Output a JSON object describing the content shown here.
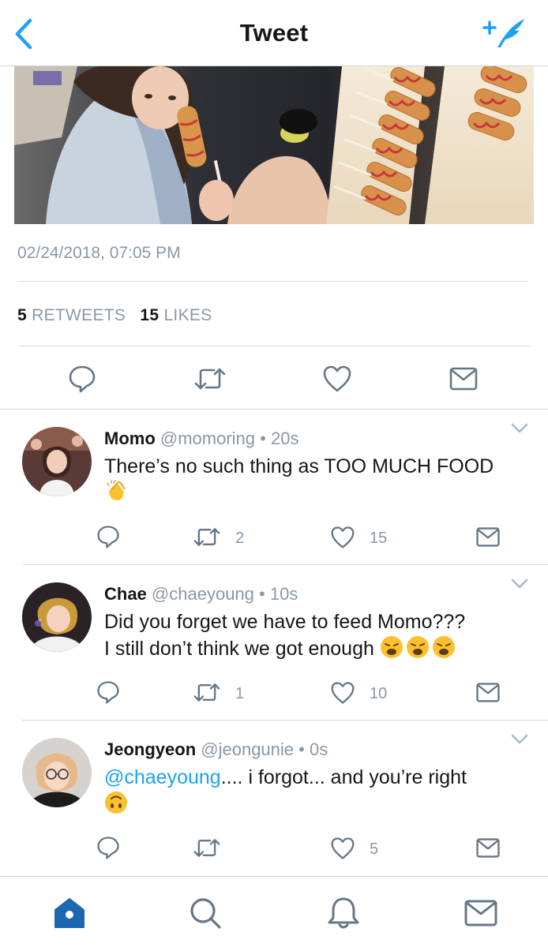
{
  "nav": {
    "title": "Tweet",
    "back_icon": "chevron-left-icon",
    "compose_icon": "compose-tweet-icon"
  },
  "tweet": {
    "timestamp": "02/24/2018, 07:05 PM",
    "retweets_count": "5",
    "retweets_label": "RETWEETS",
    "likes_count": "15",
    "likes_label": "LIKES"
  },
  "replies": [
    {
      "name": "Momo",
      "handle": "@momoring",
      "sep": "•",
      "time": "20s",
      "text": "There’s no such thing as TOO MUCH FOOD",
      "retweets": "2",
      "likes": "15"
    },
    {
      "name": "Chae",
      "handle": "@chaeyoung",
      "sep": "•",
      "time": "10s",
      "line1": "Did you forget we have to feed Momo???",
      "line2": "I still don’t think we got enough",
      "retweets": "1",
      "likes": "10"
    },
    {
      "name": "Jeongyeon",
      "handle": "@jeongunie",
      "sep": "•",
      "time": "0s",
      "mention": "@chaeyoung",
      "text": ".... i forgot... and you’re right",
      "retweets": "",
      "likes": "5"
    }
  ],
  "tabs": [
    "home-icon",
    "search-icon",
    "notifications-bell-icon",
    "messages-envelope-icon"
  ],
  "colors": {
    "accent": "#1da1f2",
    "secondary_text": "#8899a6",
    "primary_text": "#14171a",
    "action_icon": "#657786"
  }
}
